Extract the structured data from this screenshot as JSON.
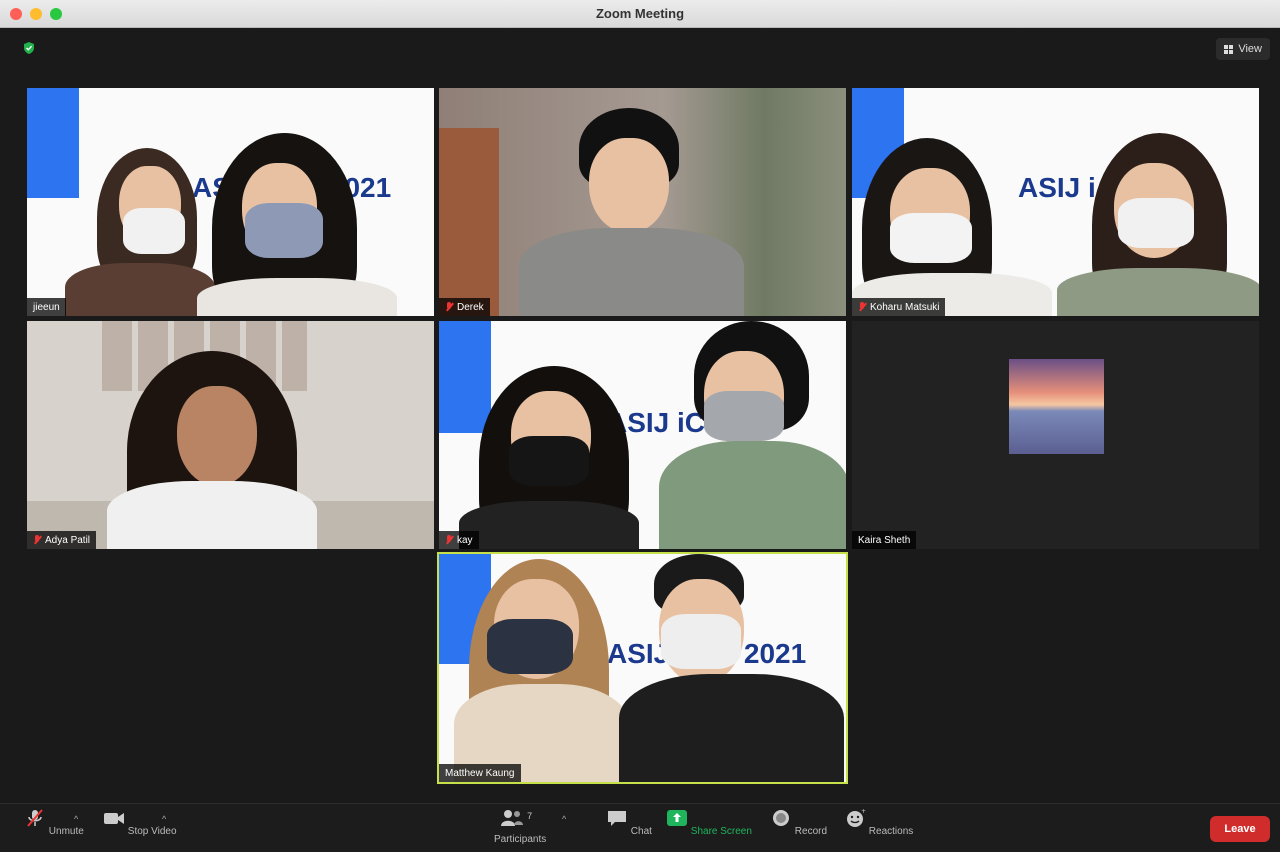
{
  "window": {
    "title": "Zoom Meeting"
  },
  "header": {
    "view_label": "View"
  },
  "tiles": [
    {
      "name": "jieeun",
      "banner_text": "ASIJ iC M 2021",
      "muted": false
    },
    {
      "name": "Derek",
      "muted": true
    },
    {
      "name": "Koharu Matsuki",
      "banner_text": "ASIJ i 2021",
      "muted": true
    },
    {
      "name": "Adya Patil",
      "muted": true
    },
    {
      "name": "kay",
      "banner_text": "ASIJ iC 021",
      "muted": true
    },
    {
      "name": "Kaira Sheth",
      "muted": false
    },
    {
      "name": "Matthew Kaung",
      "banner_text": "ASIJ iC M 2021",
      "muted": false,
      "active_speaker": true
    }
  ],
  "toolbar": {
    "unmute": "Unmute",
    "stop_video": "Stop Video",
    "participants": "Participants",
    "participants_count": "7",
    "chat": "Chat",
    "share_screen": "Share Screen",
    "record": "Record",
    "reactions": "Reactions",
    "leave": "Leave"
  },
  "colors": {
    "accent_green": "#1fb55d",
    "leave_red": "#d02c2c",
    "active_border": "#c6e04a",
    "banner_blue": "#2d74f0"
  }
}
